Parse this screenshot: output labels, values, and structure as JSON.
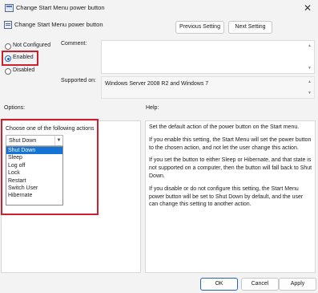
{
  "window": {
    "title": "Change Start Menu power button",
    "close_glyph": "✕"
  },
  "header": {
    "policy_name": "Change Start Menu power button",
    "previous_label": "Previous Setting",
    "next_label": "Next Setting"
  },
  "state": {
    "options": [
      {
        "label": "Not Configured",
        "checked": false
      },
      {
        "label": "Enabled",
        "checked": true
      },
      {
        "label": "Disabled",
        "checked": false
      }
    ]
  },
  "comment": {
    "label": "Comment:",
    "value": ""
  },
  "supported": {
    "label": "Supported on:",
    "value": "Windows Server 2008 R2 and Windows 7"
  },
  "options_pane": {
    "label": "Options:",
    "prompt": "Choose one of the following actions",
    "selected": "Shut Down",
    "items": [
      "Shut Down",
      "Sleep",
      "Log off",
      "Lock",
      "Restart",
      "Switch User",
      "Hibernate"
    ]
  },
  "help_pane": {
    "label": "Help:",
    "paragraphs": [
      "Set the default action of the power button on the Start menu.",
      "If you enable this setting, the Start Menu will set the power button to the chosen action, and not let the user change this action.",
      "If you set the button to either Sleep or Hibernate, and that state is not supported on a computer, then the button will fall back to Shut Down.",
      "If you disable or do not configure this setting, the Start Menu power button will be set to Shut Down by default, and the user can change this setting to another action."
    ]
  },
  "footer": {
    "ok_label": "OK",
    "cancel_label": "Cancel",
    "apply_label": "Apply"
  },
  "icons": [
    "policy-icon",
    "close-icon",
    "chevron-down-icon"
  ],
  "colors": {
    "highlight": "#d0202f",
    "selected_item": "#1673d6",
    "radio_accent": "#1d5fc5"
  }
}
